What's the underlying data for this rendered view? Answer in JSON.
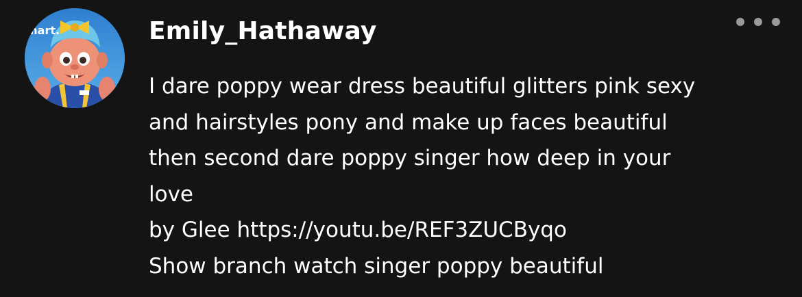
{
  "comment": {
    "avatar": {
      "icon": "troll-character-avatar-icon",
      "badge_text": "mart."
    },
    "username": "Emily_Hathaway",
    "more_icon": "more-horizontal-icon",
    "body": {
      "line1": "I dare poppy wear dress beautiful glitters pink sexy",
      "line2": "and hairstyles pony and make up faces beautiful",
      "line3": "then second dare poppy singer how deep in your",
      "line4": "love",
      "line5_prefix": "by Glee ",
      "link": "https://youtu.be/REF3ZUCByqo",
      "line6": "Show branch watch singer poppy beautiful"
    }
  }
}
